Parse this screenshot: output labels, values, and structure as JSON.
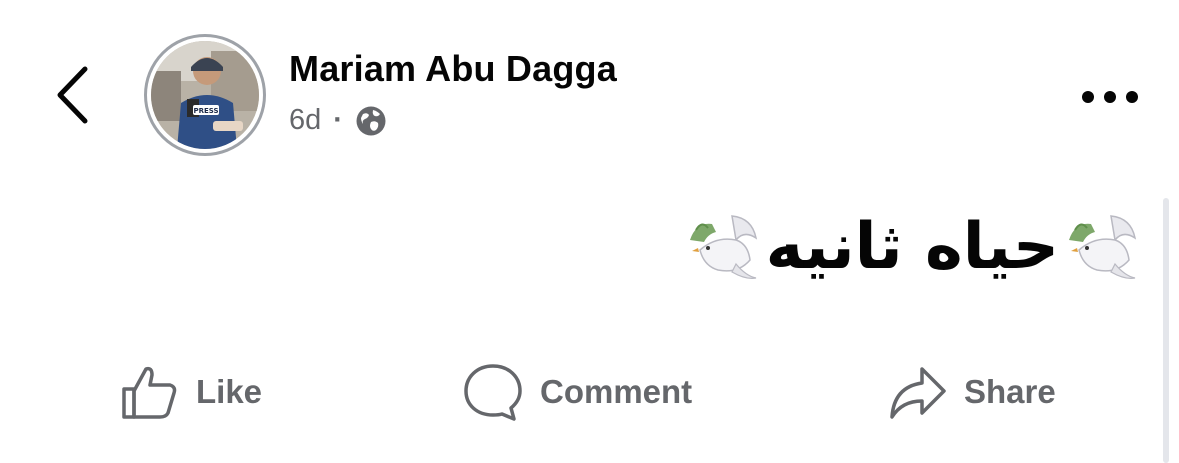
{
  "header": {
    "author_name": "Mariam Abu Dagga",
    "timestamp": "6d",
    "separator": "·",
    "privacy_icon": "globe-icon",
    "back_icon": "chevron-left-icon",
    "more_icon": "more-horizontal-icon",
    "avatar_vest_label": "PRESS"
  },
  "post": {
    "text": "حياه ثانيه",
    "emoji_icon": "dove-icon"
  },
  "actions": [
    {
      "label": "Like",
      "icon": "thumbs-up-icon"
    },
    {
      "label": "Comment",
      "icon": "comment-bubble-icon"
    },
    {
      "label": "Share",
      "icon": "share-arrow-icon"
    }
  ],
  "colors": {
    "primary_text": "#050505",
    "secondary_text": "#65676b",
    "avatar_ring": "#9ea2a8"
  }
}
